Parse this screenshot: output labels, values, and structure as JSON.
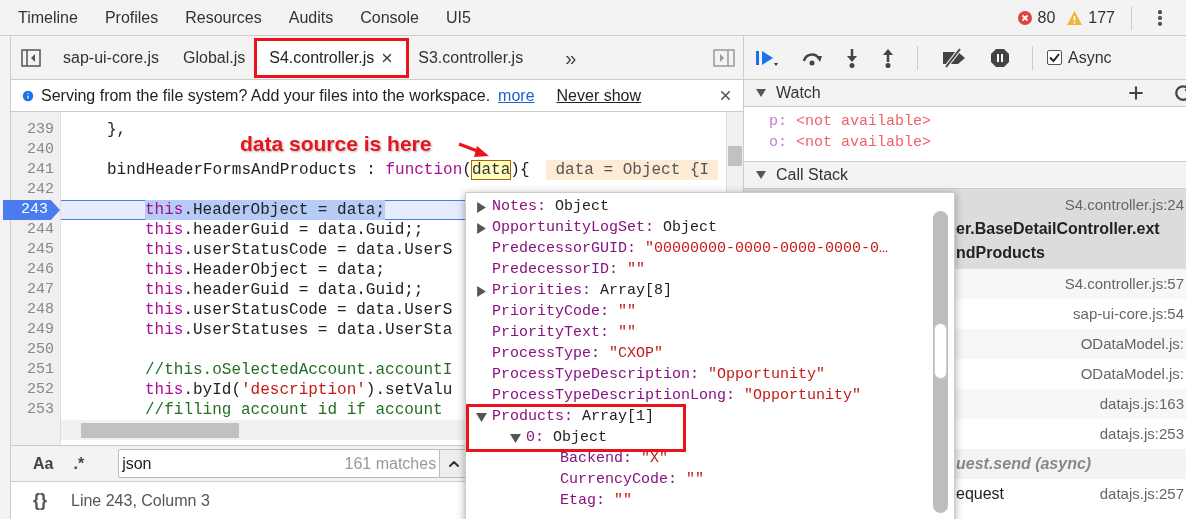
{
  "top_tabs": [
    "Timeline",
    "Profiles",
    "Resources",
    "Audits",
    "Console",
    "UI5"
  ],
  "counts": {
    "errors": "80",
    "warnings": "177"
  },
  "file_tabs": [
    {
      "label": "sap-ui-core.js",
      "selected": false
    },
    {
      "label": "Global.js",
      "selected": false
    },
    {
      "label": "S4.controller.js",
      "selected": true
    },
    {
      "label": "S3.controller.js",
      "selected": false
    }
  ],
  "more_tabs": "»",
  "info_bar": {
    "message": "Serving from the file system? Add your files into the workspace.",
    "link": "more",
    "dismiss": "Never show"
  },
  "annotation": {
    "text": "data source is here"
  },
  "code_lines": [
    {
      "number": "239",
      "selected": false,
      "kind": "member",
      "tokens": [
        {
          "kind": "plain",
          "text": "},"
        }
      ]
    },
    {
      "number": "240",
      "selected": false,
      "kind": "blank"
    },
    {
      "number": "241",
      "selected": false,
      "kind": "member",
      "tokens": [
        {
          "kind": "plain",
          "text": "bindHeaderFormsAndProducts : "
        },
        {
          "kind": "keyword",
          "text": "function"
        },
        {
          "kind": "plain",
          "text": "("
        },
        {
          "kind": "param",
          "text": "data"
        },
        {
          "kind": "plain",
          "text": "){"
        }
      ],
      "inline_value": "data = Object {I"
    },
    {
      "number": "242",
      "selected": false,
      "kind": "blank"
    },
    {
      "number": "243",
      "selected": true,
      "kind": "statement",
      "tokens": [
        {
          "kind": "keyword",
          "text": "this"
        },
        {
          "kind": "plain",
          "text": ".HeaderObject = data;"
        }
      ]
    },
    {
      "number": "244",
      "selected": false,
      "kind": "statement",
      "tokens": [
        {
          "kind": "keyword",
          "text": "this"
        },
        {
          "kind": "plain",
          "text": ".headerGuid = data.Guid;;"
        }
      ]
    },
    {
      "number": "245",
      "selected": false,
      "kind": "statement",
      "tokens": [
        {
          "kind": "keyword",
          "text": "this"
        },
        {
          "kind": "plain",
          "text": ".userStatusCode = data.UserS"
        }
      ]
    },
    {
      "number": "246",
      "selected": false,
      "kind": "statement",
      "tokens": [
        {
          "kind": "keyword",
          "text": "this"
        },
        {
          "kind": "plain",
          "text": ".HeaderObject = data;"
        }
      ]
    },
    {
      "number": "247",
      "selected": false,
      "kind": "statement",
      "tokens": [
        {
          "kind": "keyword",
          "text": "this"
        },
        {
          "kind": "plain",
          "text": ".headerGuid = data.Guid;;"
        }
      ]
    },
    {
      "number": "248",
      "selected": false,
      "kind": "statement",
      "tokens": [
        {
          "kind": "keyword",
          "text": "this"
        },
        {
          "kind": "plain",
          "text": ".userStatusCode = data.UserS"
        }
      ]
    },
    {
      "number": "249",
      "selected": false,
      "kind": "statement",
      "tokens": [
        {
          "kind": "keyword",
          "text": "this"
        },
        {
          "kind": "plain",
          "text": ".UserStatuses = data.UserSta"
        }
      ]
    },
    {
      "number": "250",
      "selected": false,
      "kind": "blank"
    },
    {
      "number": "251",
      "selected": false,
      "kind": "statement",
      "tokens": [
        {
          "kind": "comment",
          "text": "//this.oSelectedAccount.accountI"
        }
      ]
    },
    {
      "number": "252",
      "selected": false,
      "kind": "statement",
      "tokens": [
        {
          "kind": "keyword",
          "text": "this"
        },
        {
          "kind": "plain",
          "text": ".byId("
        },
        {
          "kind": "string",
          "text": "'description'"
        },
        {
          "kind": "plain",
          "text": ").setValu"
        }
      ]
    },
    {
      "number": "253",
      "selected": false,
      "kind": "statement",
      "tokens": [
        {
          "kind": "comment",
          "text": "//filling account id if account"
        }
      ]
    }
  ],
  "search": {
    "case_toggle": "Aa",
    "regex_toggle": ".*",
    "value": "json",
    "matches": "161 matches"
  },
  "status_bar": {
    "format_button": "{}",
    "position": "Line 243, Column 3"
  },
  "debugger": {
    "async": {
      "label": "Async",
      "checked": true
    }
  },
  "watch": {
    "title": "Watch",
    "expanded": true,
    "items": [
      {
        "name": "p:",
        "value": "<not available>"
      },
      {
        "name": "o:",
        "value": "<not available>"
      }
    ]
  },
  "call_stack": {
    "title": "Call Stack",
    "expanded": true,
    "frames": [
      {
        "kind": "frame",
        "selected": true,
        "location": "S4.controller.js:24",
        "name_lines": [
          "er.BaseDetailController.ext",
          "ndProducts"
        ]
      },
      {
        "kind": "frame",
        "selected": false,
        "location": "S4.controller.js:57"
      },
      {
        "kind": "frame",
        "selected": false,
        "location": "sap-ui-core.js:54"
      },
      {
        "kind": "frame",
        "selected": false,
        "location": "ODataModel.js:"
      },
      {
        "kind": "frame",
        "selected": false,
        "location": "ODataModel.js:"
      },
      {
        "kind": "frame",
        "selected": false,
        "location": "datajs.js:163"
      },
      {
        "kind": "frame",
        "selected": false,
        "location": "datajs.js:253"
      },
      {
        "kind": "async",
        "label": "uest.send (async)"
      },
      {
        "kind": "frame",
        "selected": false,
        "location": "datajs.js:257",
        "name_lines": [
          "equest"
        ]
      }
    ]
  },
  "popover": {
    "items": [
      {
        "kind": "node",
        "name": "Notes:",
        "value": "Object",
        "expanded": false
      },
      {
        "kind": "node",
        "name": "OpportunityLogSet:",
        "value": "Object",
        "expanded": false
      },
      {
        "kind": "leaf",
        "name": "PredecessorGUID:",
        "value": "\"00000000-0000-0000-0000-0…"
      },
      {
        "kind": "leaf",
        "name": "PredecessorID:",
        "value": "\"\""
      },
      {
        "kind": "node",
        "name": "Priorities:",
        "value": "Array[8]",
        "expanded": false
      },
      {
        "kind": "leaf",
        "name": "PriorityCode:",
        "value": "\"\""
      },
      {
        "kind": "leaf",
        "name": "PriorityText:",
        "value": "\"\""
      },
      {
        "kind": "leaf",
        "name": "ProcessType:",
        "value": "\"CXOP\""
      },
      {
        "kind": "leaf",
        "name": "ProcessTypeDescription:",
        "value": "\"Opportunity\""
      },
      {
        "kind": "leaf",
        "name": "ProcessTypeDescriptionLong:",
        "value": "\"Opportunity\""
      },
      {
        "kind": "node",
        "name": "Products:",
        "value": "Array[1]",
        "expanded": true,
        "children": [
          {
            "kind": "node",
            "name": "0:",
            "value": "Object",
            "expanded": true,
            "children": [
              {
                "kind": "leaf",
                "name": "Backend:",
                "value": "\"X\""
              },
              {
                "kind": "leaf",
                "name": "CurrencyCode:",
                "value": "\"\""
              },
              {
                "kind": "leaf",
                "name": "Etag:",
                "value": "\"\""
              }
            ]
          }
        ]
      }
    ]
  }
}
